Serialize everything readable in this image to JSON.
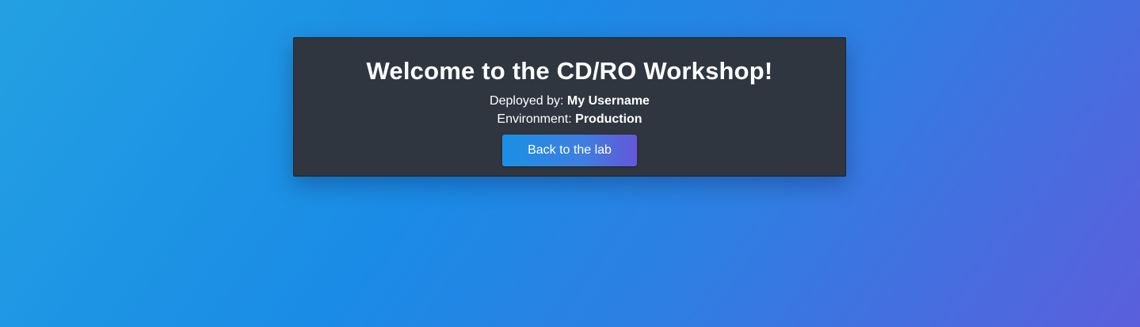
{
  "card": {
    "title": "Welcome to the CD/RO Workshop!",
    "deployed_by_label": "Deployed by: ",
    "deployed_by_value": "My Username",
    "environment_label": "Environment: ",
    "environment_value": "Production",
    "button_label": "Back to the lab"
  },
  "colors": {
    "card_background": "#2f3640",
    "background_gradient_start": "#23a0e2",
    "background_gradient_end": "#5b5fdc",
    "button_gradient_start": "#1a90e4",
    "button_gradient_end": "#6358d8",
    "text": "#ffffff"
  }
}
